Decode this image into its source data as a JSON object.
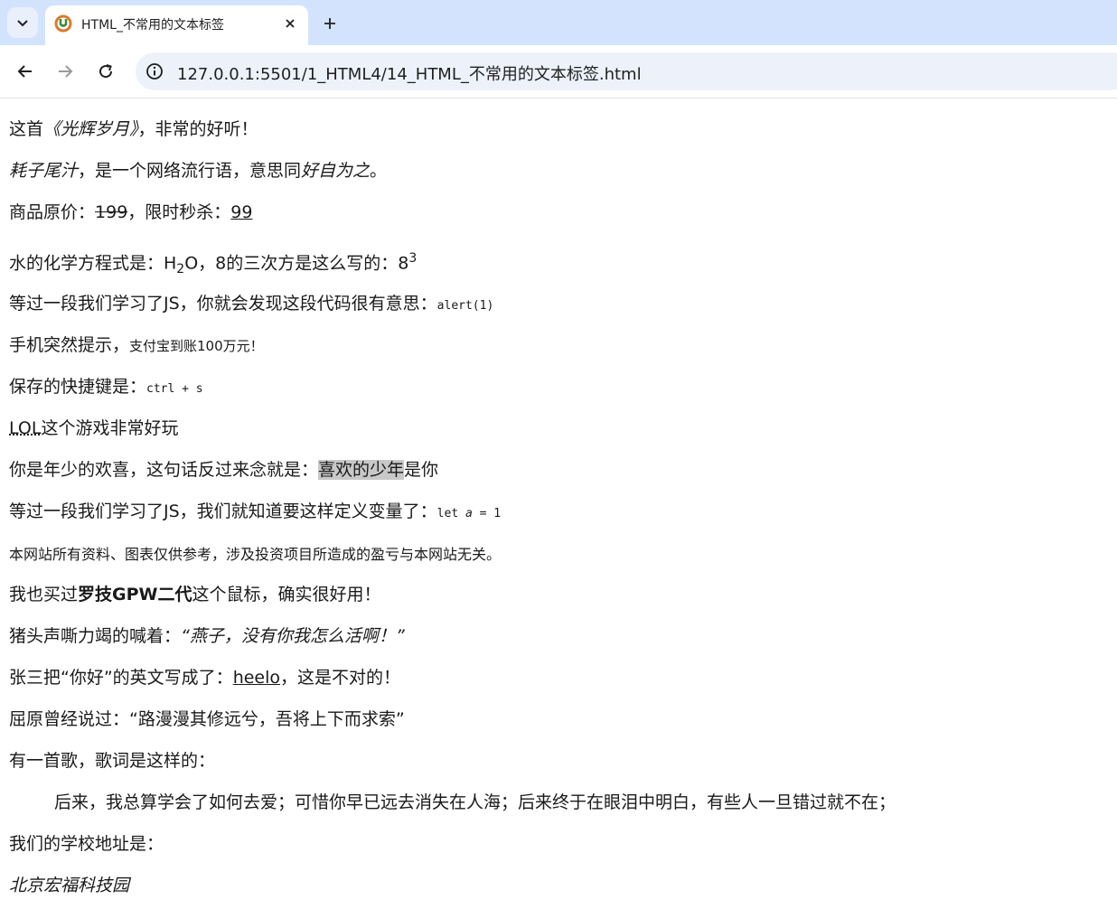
{
  "browser": {
    "tab_title": "HTML_不常用的文本标签",
    "url": "127.0.0.1:5501/1_HTML4/14_HTML_不常用的文本标签.html"
  },
  "content": {
    "l1": {
      "a": "这首",
      "cite": "《光辉岁月》",
      "b": "，非常的好听！"
    },
    "l2": {
      "dfn": "耗子尾汁",
      "a": "，是一个网络流行语，意思同",
      "em": "好自为之",
      "b": "。"
    },
    "l3": {
      "a": "商品原价：",
      "del": "199",
      "b": "，限时秒杀：",
      "ins": "99"
    },
    "l4": {
      "a": "水的化学方程式是：H",
      "sub": "2",
      "b": "O，8的三次方是这么写的：8",
      "sup": "3"
    },
    "l5": {
      "a": "等过一段我们学习了JS，你就会发现这段代码很有意思：",
      "code": "alert(1)"
    },
    "l6": {
      "a": "手机突然提示，",
      "samp": "支付宝到账100万元！"
    },
    "l7": {
      "a": "保存的快捷键是：",
      "kbd": "ctrl + s"
    },
    "l8": {
      "abbr": "LOL",
      "a": "这个游戏非常好玩"
    },
    "l9": {
      "a": "你是年少的欢喜，这句话反过来念就是：",
      "mark": "喜欢的少年",
      "b": "是你"
    },
    "l10": {
      "a": "等过一段我们学习了JS，我们就知道要这样定义变量了：",
      "code1": "let ",
      "var": "a",
      "code2": " = 1"
    },
    "l11": {
      "small": "本网站所有资料、图表仅供参考，涉及投资项目所造成的盈亏与本网站无关。"
    },
    "l12": {
      "a": "我也买过",
      "strong": "罗技GPW二代",
      "b": "这个鼠标，确实很好用！"
    },
    "l13": {
      "a": "猪头声嘶力竭的喊着：",
      "q": "“燕子，没有你我怎么活啊！”"
    },
    "l14": {
      "a": "张三把“你好”的英文写成了：",
      "u": "heelo",
      "b": "，这是不对的！"
    },
    "l15": {
      "a": "屈原曾经说过：“路漫漫其修远兮，吾将上下而求索”"
    },
    "l16": {
      "a": "有一首歌，歌词是这样的："
    },
    "l17": {
      "a": "后来，我总算学会了如何去爱；可惜你早已远去消失在人海；后来终于在眼泪中明白，有些人一旦错过就不在；"
    },
    "l18": {
      "a": "我们的学校地址是："
    },
    "l19": {
      "address": "北京宏福科技园"
    }
  }
}
